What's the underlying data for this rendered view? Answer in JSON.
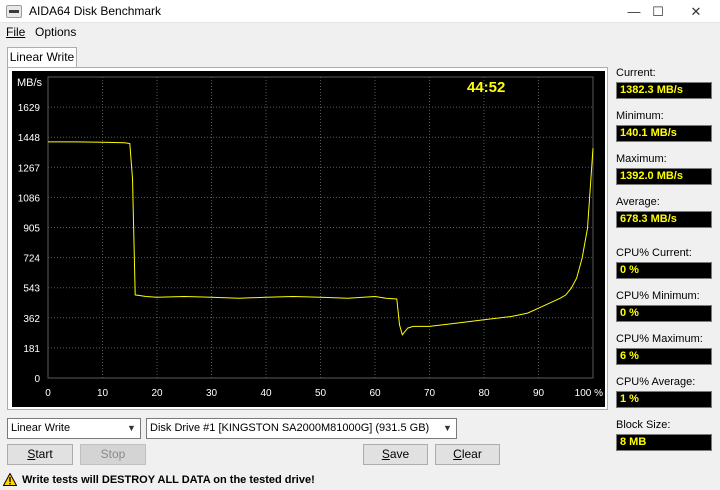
{
  "window": {
    "title": "AIDA64 Disk Benchmark"
  },
  "menu": {
    "file": "File",
    "options": "Options"
  },
  "tab": {
    "label": "Linear Write"
  },
  "chart": {
    "timer": "44:52",
    "unit": "MB/s",
    "y_ticks": [
      "1629",
      "1448",
      "1267",
      "1086",
      "905",
      "724",
      "543",
      "362",
      "181",
      "0"
    ],
    "x_ticks": [
      "0",
      "10",
      "20",
      "30",
      "40",
      "50",
      "60",
      "70",
      "80",
      "90",
      "100 %"
    ],
    "line_color": "#ffff00",
    "grid_color": "#5a5a5a",
    "background_color": "#000000"
  },
  "chart_data": {
    "type": "line",
    "title": "",
    "xlabel": "",
    "ylabel": "MB/s",
    "xlim": [
      0,
      100
    ],
    "ylim": [
      0,
      1810
    ],
    "grid": true,
    "series": [
      {
        "x": [
          0,
          5,
          10,
          14,
          15,
          15.5,
          16,
          18,
          20,
          25,
          30,
          35,
          40,
          45,
          50,
          55,
          60,
          62,
          64,
          64.5,
          65,
          66,
          67,
          70,
          75,
          80,
          85,
          88,
          90,
          92,
          94,
          95,
          96,
          97,
          98,
          99,
          100
        ],
        "y": [
          1420,
          1420,
          1418,
          1415,
          1410,
          1200,
          500,
          490,
          485,
          490,
          485,
          480,
          485,
          490,
          485,
          480,
          490,
          480,
          475,
          320,
          260,
          300,
          310,
          310,
          330,
          350,
          370,
          390,
          420,
          450,
          480,
          500,
          540,
          600,
          720,
          900,
          1382
        ]
      }
    ]
  },
  "stats": {
    "current_label": "Current:",
    "current_value": "1382.3 MB/s",
    "minimum_label": "Minimum:",
    "minimum_value": "140.1 MB/s",
    "maximum_label": "Maximum:",
    "maximum_value": "1392.0 MB/s",
    "average_label": "Average:",
    "average_value": "678.3 MB/s",
    "cpu_current_label": "CPU% Current:",
    "cpu_current_value": "0 %",
    "cpu_minimum_label": "CPU% Minimum:",
    "cpu_minimum_value": "0 %",
    "cpu_maximum_label": "CPU% Maximum:",
    "cpu_maximum_value": "6 %",
    "cpu_average_label": "CPU% Average:",
    "cpu_average_value": "1 %",
    "block_size_label": "Block Size:",
    "block_size_value": "8 MB"
  },
  "controls": {
    "test_select": "Linear Write",
    "drive_select": "Disk Drive #1  [KINGSTON SA2000M81000G]  (931.5 GB)",
    "start_rest": "tart",
    "start_mnemonic": "S",
    "stop_label": "Stop",
    "save_mnemonic": "S",
    "save_rest": "ave",
    "clear_mnemonic": "C",
    "clear_rest": "lear"
  },
  "warning": {
    "text": "Write tests will DESTROY ALL DATA on the tested drive!"
  }
}
